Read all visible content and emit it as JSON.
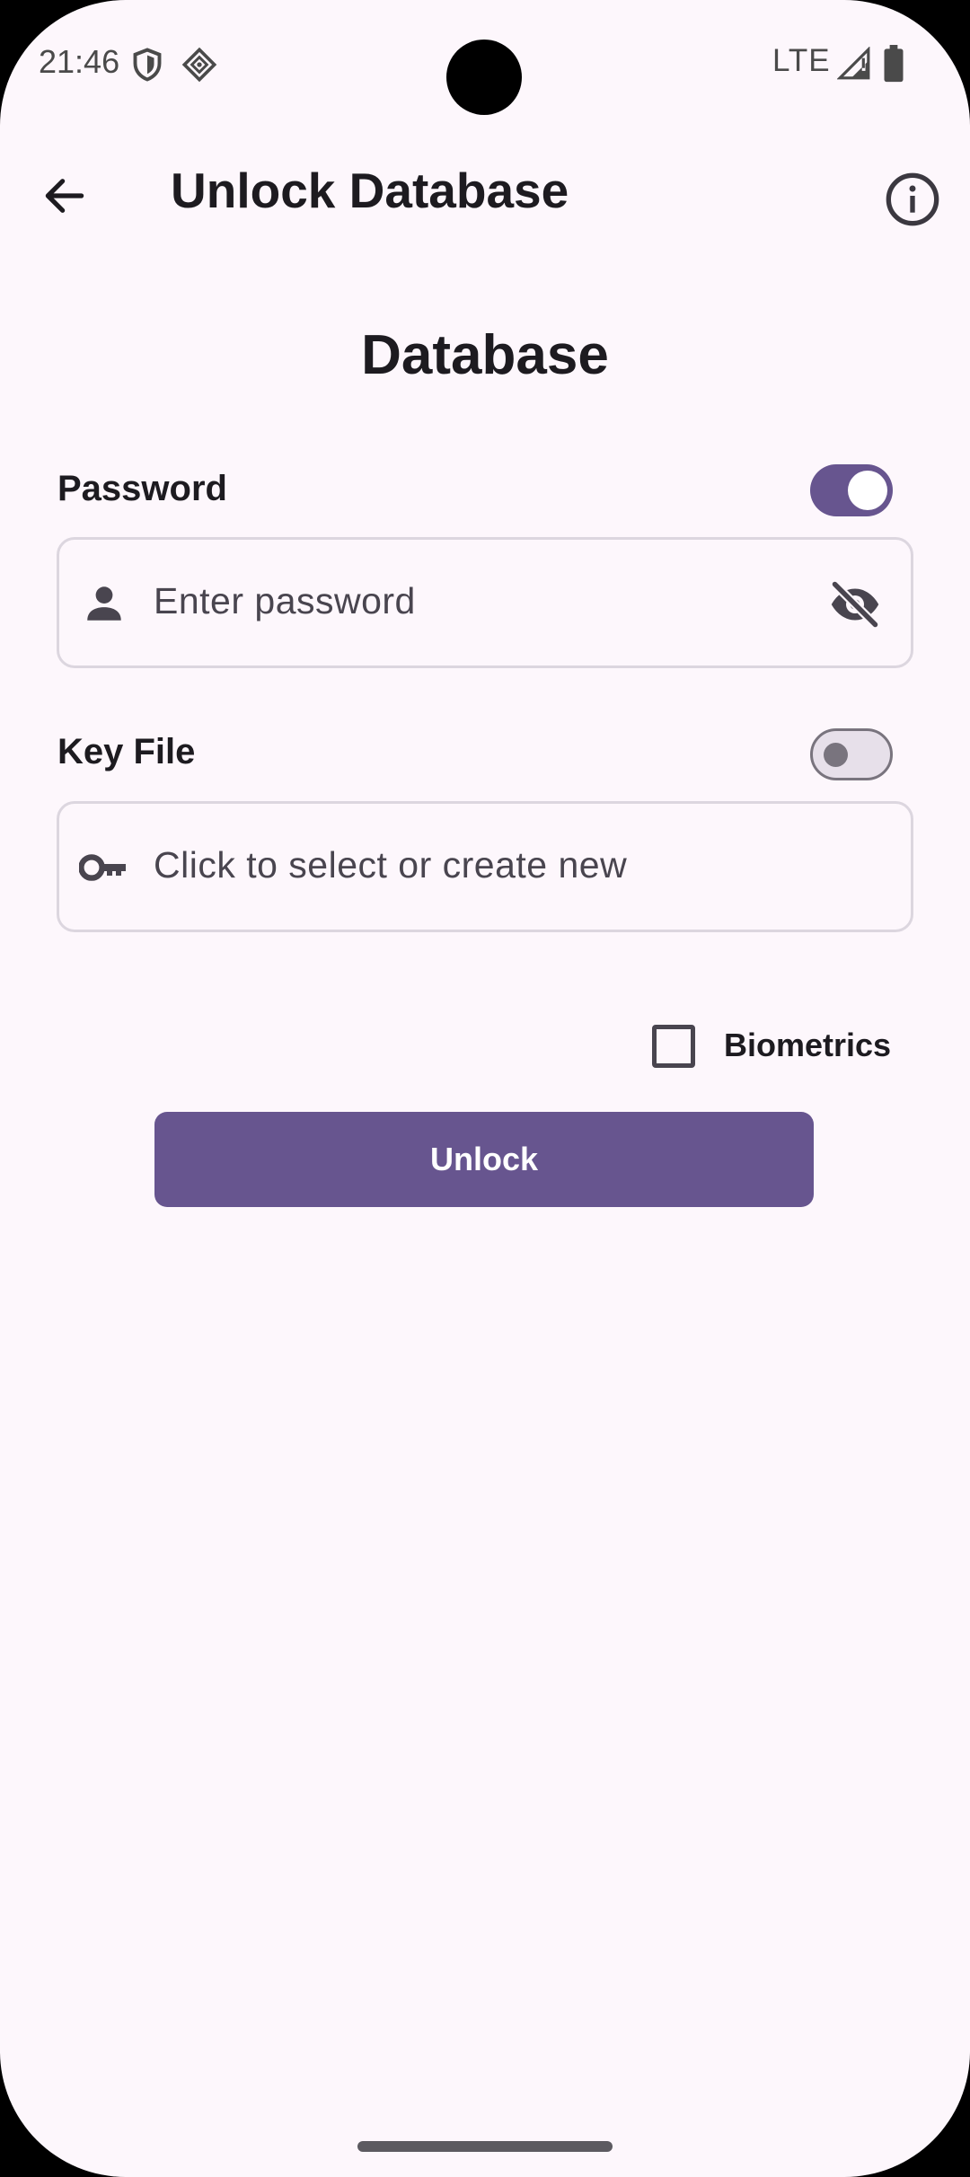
{
  "status_bar": {
    "time": "21:46",
    "network": "LTE",
    "icons": [
      "shield-icon",
      "app-notification-icon",
      "signal-icon",
      "battery-icon"
    ]
  },
  "app_bar": {
    "title": "Unlock Database",
    "back_icon": "arrow-back-icon",
    "info_icon": "info-icon"
  },
  "main": {
    "heading": "Database",
    "password": {
      "label": "Password",
      "enabled": true,
      "placeholder": "Enter password",
      "lead_icon": "person-icon",
      "trail_icon": "visibility-off-icon"
    },
    "key_file": {
      "label": "Key File",
      "enabled": false,
      "placeholder": "Click to select or create new",
      "lead_icon": "key-icon"
    },
    "biometrics": {
      "label": "Biometrics",
      "checked": false
    },
    "unlock_label": "Unlock"
  },
  "colors": {
    "background": "#fdf7fc",
    "accent": "#67558f",
    "text": "#1d1b20"
  }
}
